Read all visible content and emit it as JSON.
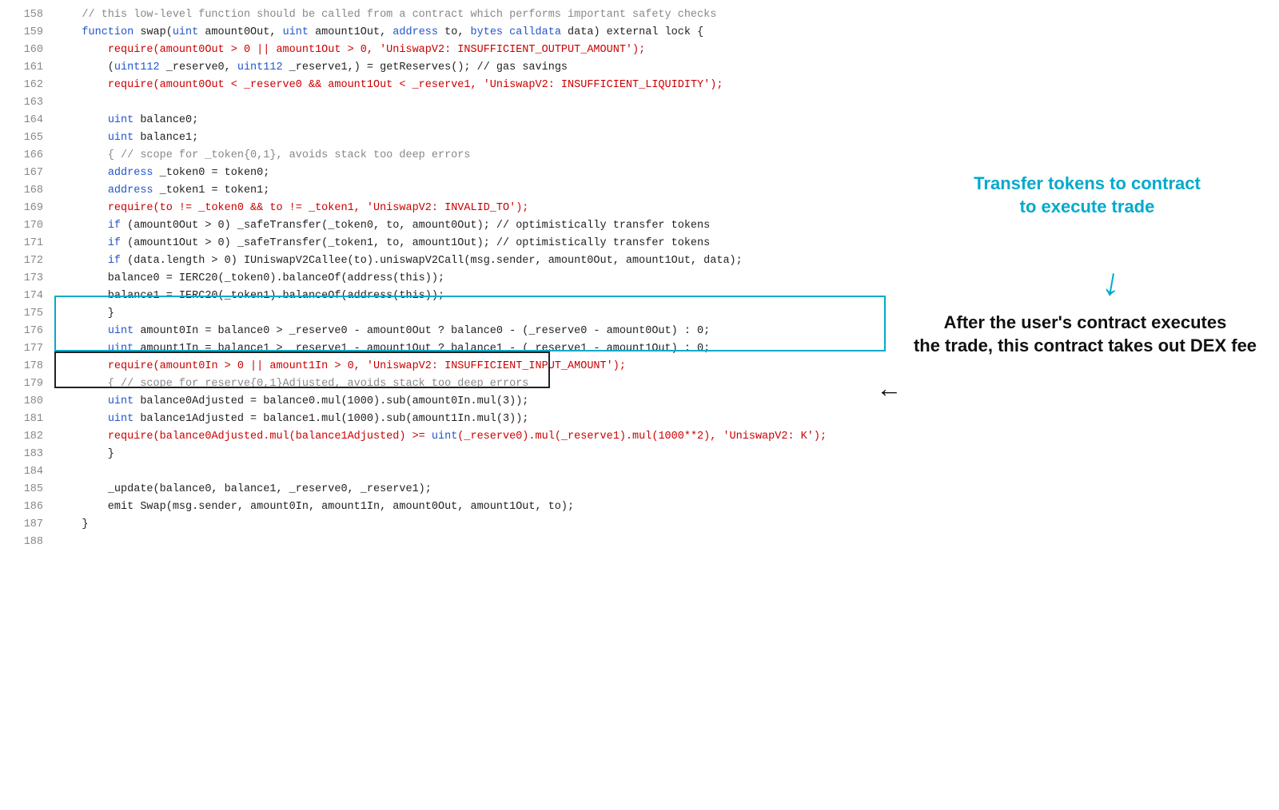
{
  "lines": [
    {
      "num": "158",
      "content": [
        {
          "t": "    // this low-level function should be called from a contract which performs important safety checks",
          "c": "comment"
        }
      ]
    },
    {
      "num": "159",
      "content": [
        {
          "t": "    ",
          "c": ""
        },
        {
          "t": "function",
          "c": "blue-kw"
        },
        {
          "t": " swap(",
          "c": ""
        },
        {
          "t": "uint",
          "c": "blue-kw"
        },
        {
          "t": " amount0Out, ",
          "c": ""
        },
        {
          "t": "uint",
          "c": "blue-kw"
        },
        {
          "t": " amount1Out, ",
          "c": ""
        },
        {
          "t": "address",
          "c": "blue-kw"
        },
        {
          "t": " to, ",
          "c": ""
        },
        {
          "t": "bytes calldata",
          "c": "blue-kw"
        },
        {
          "t": " data) external lock {",
          "c": ""
        }
      ]
    },
    {
      "num": "160",
      "content": [
        {
          "t": "        ",
          "c": ""
        },
        {
          "t": "require",
          "c": "red"
        },
        {
          "t": "(amount0Out > 0 || amount1Out > 0, 'UniswapV2: INSUFFICIENT_OUTPUT_AMOUNT');",
          "c": "red"
        }
      ]
    },
    {
      "num": "161",
      "content": [
        {
          "t": "        (",
          "c": ""
        },
        {
          "t": "uint112",
          "c": "blue-kw"
        },
        {
          "t": " _reserve0, ",
          "c": ""
        },
        {
          "t": "uint112",
          "c": "blue-kw"
        },
        {
          "t": " _reserve1,) = getReserves(); // gas savings",
          "c": ""
        }
      ]
    },
    {
      "num": "162",
      "content": [
        {
          "t": "        ",
          "c": ""
        },
        {
          "t": "require",
          "c": "red"
        },
        {
          "t": "(amount0Out < _reserve0 && amount1Out < _reserve1, 'UniswapV2: INSUFFICIENT_LIQUIDITY');",
          "c": "red"
        }
      ]
    },
    {
      "num": "163",
      "content": [
        {
          "t": "",
          "c": ""
        }
      ]
    },
    {
      "num": "164",
      "content": [
        {
          "t": "        ",
          "c": ""
        },
        {
          "t": "uint",
          "c": "blue-kw"
        },
        {
          "t": " balance0;",
          "c": ""
        }
      ]
    },
    {
      "num": "165",
      "content": [
        {
          "t": "        ",
          "c": ""
        },
        {
          "t": "uint",
          "c": "blue-kw"
        },
        {
          "t": " balance1;",
          "c": ""
        }
      ]
    },
    {
      "num": "166",
      "content": [
        {
          "t": "        { // scope for _token{0,1}, avoids stack too deep errors",
          "c": "comment"
        }
      ]
    },
    {
      "num": "167",
      "content": [
        {
          "t": "        ",
          "c": ""
        },
        {
          "t": "address",
          "c": "blue-kw"
        },
        {
          "t": " _token0 = token0;",
          "c": ""
        }
      ]
    },
    {
      "num": "168",
      "content": [
        {
          "t": "        ",
          "c": ""
        },
        {
          "t": "address",
          "c": "blue-kw"
        },
        {
          "t": " _token1 = token1;",
          "c": ""
        }
      ]
    },
    {
      "num": "169",
      "content": [
        {
          "t": "        ",
          "c": ""
        },
        {
          "t": "require",
          "c": "red"
        },
        {
          "t": "(to != _token0 && to != _token1, 'UniswapV2: INVALID_TO');",
          "c": "red"
        }
      ]
    },
    {
      "num": "170",
      "content": [
        {
          "t": "        ",
          "c": ""
        },
        {
          "t": "if",
          "c": "blue-kw"
        },
        {
          "t": " (amount0Out > 0) _safeTransfer(_token0, to, amount0Out); // optimistically transfer tokens",
          "c": ""
        }
      ]
    },
    {
      "num": "171",
      "content": [
        {
          "t": "        ",
          "c": ""
        },
        {
          "t": "if",
          "c": "blue-kw"
        },
        {
          "t": " (amount1Out > 0) _safeTransfer(_token1, to, amount1Out); // optimistically transfer tokens",
          "c": ""
        }
      ]
    },
    {
      "num": "172",
      "content": [
        {
          "t": "        ",
          "c": ""
        },
        {
          "t": "if",
          "c": "blue-kw"
        },
        {
          "t": " (data.length > 0) IUniswapV2Callee(to).uniswapV2Call(msg.sender, amount0Out, amount1Out, data);",
          "c": ""
        }
      ]
    },
    {
      "num": "173",
      "content": [
        {
          "t": "        balance0 = IERC20(_token0).balanceOf(address(this));",
          "c": ""
        }
      ]
    },
    {
      "num": "174",
      "content": [
        {
          "t": "        balance1 = IERC20(_token1).balanceOf(address(this));",
          "c": ""
        }
      ]
    },
    {
      "num": "175",
      "content": [
        {
          "t": "        }",
          "c": ""
        }
      ]
    },
    {
      "num": "176",
      "content": [
        {
          "t": "        ",
          "c": ""
        },
        {
          "t": "uint",
          "c": "blue-kw"
        },
        {
          "t": " amount0In = balance0 > _reserve0 - amount0Out ? balance0 - (_reserve0 - amount0Out) : 0;",
          "c": ""
        }
      ]
    },
    {
      "num": "177",
      "content": [
        {
          "t": "        ",
          "c": ""
        },
        {
          "t": "uint",
          "c": "blue-kw"
        },
        {
          "t": " amount1In = balance1 > _reserve1 - amount1Out ? balance1 - (_reserve1 - amount1Out) : 0;",
          "c": ""
        }
      ]
    },
    {
      "num": "178",
      "content": [
        {
          "t": "        ",
          "c": ""
        },
        {
          "t": "require",
          "c": "red"
        },
        {
          "t": "(amount0In > 0 || amount1In > 0, 'UniswapV2: INSUFFICIENT_INPUT_AMOUNT');",
          "c": "red"
        }
      ]
    },
    {
      "num": "179",
      "content": [
        {
          "t": "        { // scope for reserve{0,1}Adjusted, avoids stack too deep errors",
          "c": "comment"
        }
      ]
    },
    {
      "num": "180",
      "content": [
        {
          "t": "        ",
          "c": ""
        },
        {
          "t": "uint",
          "c": "blue-kw"
        },
        {
          "t": " balance0Adjusted = balance0.mul(1000).sub(amount0In.mul(3));",
          "c": ""
        }
      ]
    },
    {
      "num": "181",
      "content": [
        {
          "t": "        ",
          "c": ""
        },
        {
          "t": "uint",
          "c": "blue-kw"
        },
        {
          "t": " balance1Adjusted = balance1.mul(1000).sub(amount1In.mul(3));",
          "c": ""
        }
      ]
    },
    {
      "num": "182",
      "content": [
        {
          "t": "        ",
          "c": ""
        },
        {
          "t": "require",
          "c": "red"
        },
        {
          "t": "(balance0Adjusted.mul(balance1Adjusted) >= ",
          "c": "red"
        },
        {
          "t": "uint",
          "c": "blue-kw"
        },
        {
          "t": "(_reserve0).mul(_reserve1).mul(1000**2), 'UniswapV2: K');",
          "c": "red"
        }
      ]
    },
    {
      "num": "183",
      "content": [
        {
          "t": "        }",
          "c": ""
        }
      ]
    },
    {
      "num": "184",
      "content": [
        {
          "t": "",
          "c": ""
        }
      ]
    },
    {
      "num": "185",
      "content": [
        {
          "t": "        _update(balance0, balance1, _reserve0, _reserve1);",
          "c": ""
        }
      ]
    },
    {
      "num": "186",
      "content": [
        {
          "t": "        emit Swap(msg.sender, amount0In, amount1In, amount0Out, amount1Out, to);",
          "c": ""
        }
      ]
    },
    {
      "num": "187",
      "content": [
        {
          "t": "    }",
          "c": ""
        }
      ]
    },
    {
      "num": "188",
      "content": [
        {
          "t": "",
          "c": ""
        }
      ]
    }
  ],
  "annotations": {
    "transfer_label_line1": "Transfer tokens to contract",
    "transfer_label_line2": "to execute trade",
    "dex_label_line1": "After the user's contract executes",
    "dex_label_line2": "the trade, this contract takes out DEX fee"
  },
  "cyan_box": {
    "label": "cyan-border-box"
  },
  "dark_box": {
    "label": "dark-border-box"
  }
}
